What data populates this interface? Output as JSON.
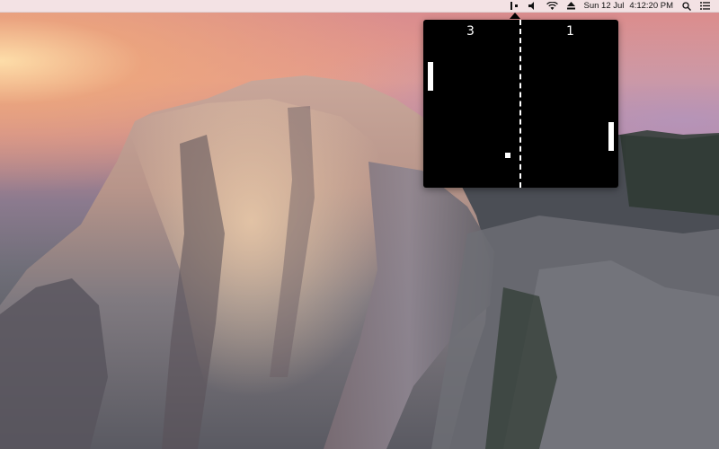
{
  "menubar": {
    "date": "Sun 12 Jul",
    "time": "4:12:20 PM",
    "icons": [
      "pong-icon",
      "volume-icon",
      "wifi-icon",
      "eject-icon",
      "search-icon",
      "notification-center-icon"
    ]
  },
  "pong": {
    "score_left": "3",
    "score_right": "1"
  },
  "colors": {
    "menubar_bg": "#f6eef0",
    "popover_bg": "#000000",
    "game_fg": "#ffffff"
  }
}
